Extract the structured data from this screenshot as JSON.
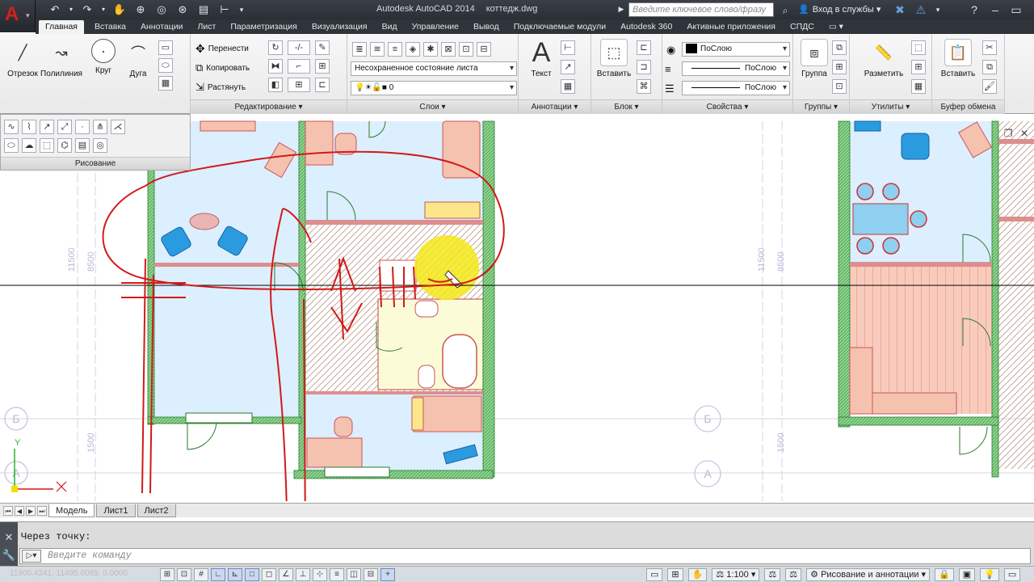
{
  "app": {
    "logo": "A",
    "title": "Autodesk AutoCAD 2014",
    "file": "коттедж.dwg",
    "search_placeholder": "Введите ключевое слово/фразу",
    "login": "Вход в службы"
  },
  "tabs": [
    "Главная",
    "Вставка",
    "Аннотации",
    "Лист",
    "Параметризация",
    "Визуализация",
    "Вид",
    "Управление",
    "Вывод",
    "Подключаемые модули",
    "Autodesk 360",
    "Активные приложения",
    "СПДС"
  ],
  "ribbon": {
    "draw": {
      "otrezok": "Отрезок",
      "polyline": "Полилиния",
      "krug": "Круг",
      "duga": "Дуга",
      "title": "Рисование"
    },
    "edit": {
      "move": "Перенести",
      "copy": "Копировать",
      "stretch": "Растянуть",
      "title": "Редактирование"
    },
    "layers": {
      "state": "Несохраненное состояние листа",
      "current": "0",
      "title": "Слои"
    },
    "annot": {
      "text": "Текст",
      "title": "Аннотации"
    },
    "block": {
      "insert": "Вставить",
      "title": "Блок"
    },
    "props": {
      "color": "ПоСлою",
      "linetype": "ПоСлою",
      "lineweight": "ПоСлою",
      "title": "Свойства"
    },
    "groups": {
      "group": "Группа",
      "title": "Группы"
    },
    "utils": {
      "measure": "Разметить",
      "title": "Утилиты"
    },
    "clipboard": {
      "paste": "Вставить",
      "title": "Буфер обмена"
    }
  },
  "plan": {
    "dims": [
      "11500",
      "8500",
      "1500",
      "11500",
      "8500",
      "1500"
    ],
    "axes": [
      "Б",
      "А",
      "Б",
      "А"
    ],
    "ucs": {
      "y": "Y"
    }
  },
  "layout_tabs": [
    "Модель",
    "Лист1",
    "Лист2"
  ],
  "command": {
    "history": "Через точку:",
    "placeholder": "Введите команду",
    "prompt_icon": "▷"
  },
  "status": {
    "coords": "11900.4241, 11495.6089, 0.0000",
    "scale": "1:100",
    "workspace": "Рисование и аннотации"
  },
  "colors": {
    "accent": "#2b6cc4",
    "red_annotation": "#d11a1a",
    "wall": "#44b04a",
    "room": "#dcefff",
    "floor_pink": "#f6c6b8"
  }
}
